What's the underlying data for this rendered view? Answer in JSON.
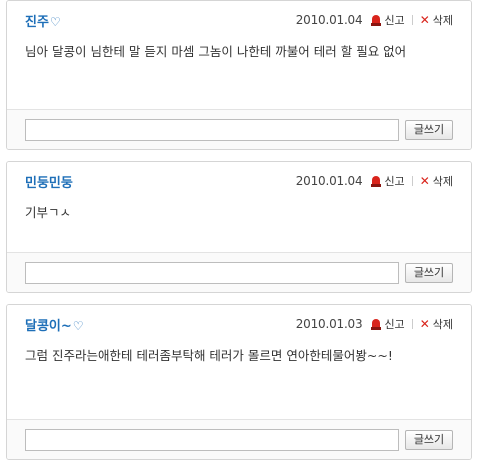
{
  "comments": [
    {
      "nick": "진주",
      "heart": "♡",
      "date": "2010.01.04",
      "report_label": "신고",
      "delete_label": "삭제",
      "content": "님아 달콩이 님한테 말 듣지 마셈 그놈이 나한테 까불어 테러 할 필요 없어",
      "reply_value": "",
      "write_label": "글쓰기"
    },
    {
      "nick": "민둥민둥",
      "heart": "",
      "date": "2010.01.04",
      "report_label": "신고",
      "delete_label": "삭제",
      "content": "기부ㄱㅅ",
      "reply_value": "",
      "write_label": "글쓰기"
    },
    {
      "nick": "달콩이~",
      "heart": "♡",
      "date": "2010.01.03",
      "report_label": "신고",
      "delete_label": "삭제",
      "content": "그럼 진주라는애한테 테러좀부탁해 테러가 몰르면 연아한테물어봥~~!",
      "reply_value": "",
      "write_label": "글쓰기"
    }
  ],
  "colors": {
    "nick": "#1e6fb8",
    "report_icon": "#d9241c",
    "delete_icon": "#d9241c",
    "border": "#d5d5d5"
  },
  "icons": {
    "report": "siren-icon",
    "delete": "x-icon"
  }
}
